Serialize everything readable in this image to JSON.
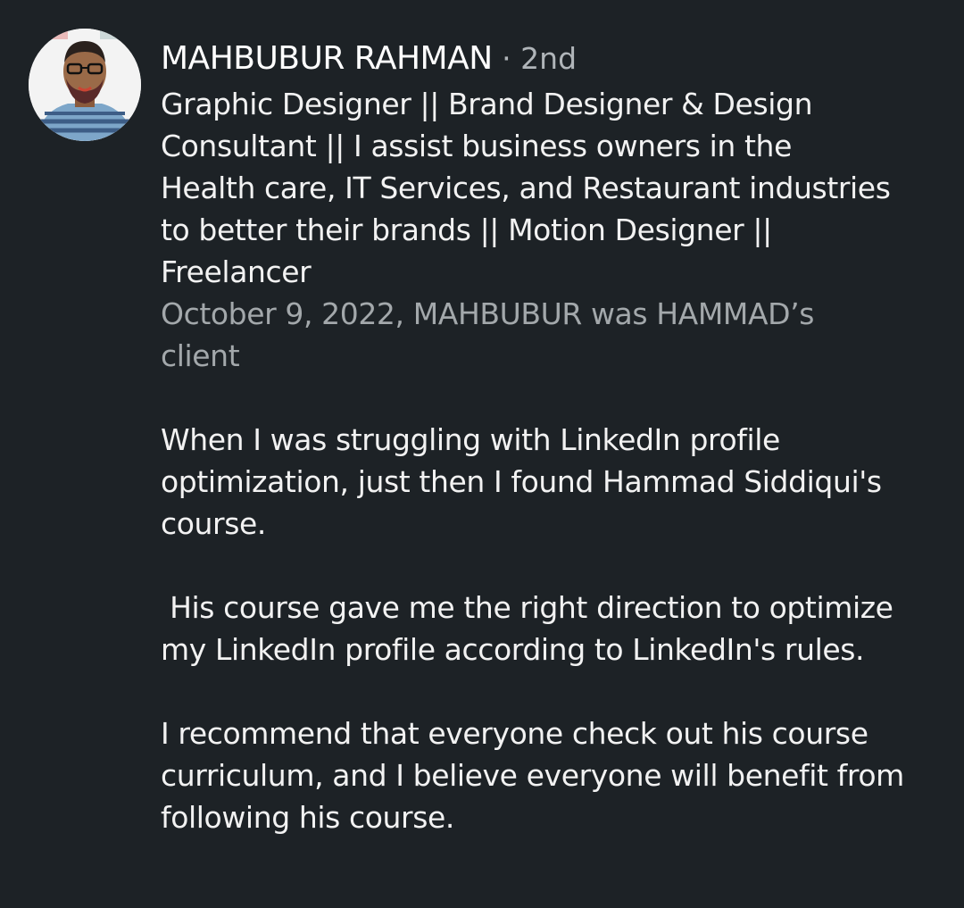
{
  "recommender": {
    "avatar_icon": "profile-photo",
    "name": "MAHBUBUR RAHMAN",
    "separator": " · ",
    "degree": "2nd",
    "headline": "Graphic Designer || Brand Designer & Design Consultant || I assist business owners in the Health care, IT Services, and Restaurant industries to better their brands || Motion Designer || Freelancer",
    "relationship": "October 9, 2022, MAHBUBUR was HAMMAD’s client"
  },
  "recommendation": {
    "paragraphs": [
      "When I was struggling with LinkedIn profile optimization, just then I found Hammad Siddiqui's course.",
      " His course gave me the right direction to optimize my LinkedIn profile according to LinkedIn's rules.",
      "I recommend that everyone check out his course curriculum, and I believe everyone will benefit from following his course."
    ]
  }
}
